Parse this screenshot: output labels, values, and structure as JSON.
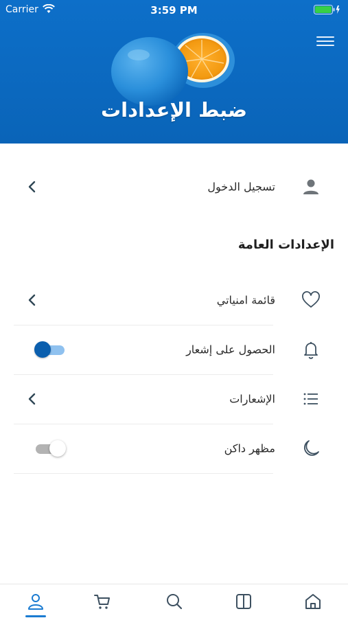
{
  "status_bar": {
    "carrier": "Carrier",
    "time": "3:59 PM"
  },
  "header": {
    "title": "ضبط الإعدادات",
    "menu_icon": "hamburger-menu-icon"
  },
  "login_row": {
    "label": "تسجيل الدخول",
    "icon": "person-icon"
  },
  "general_section": {
    "title": "الإعدادات العامة",
    "items": [
      {
        "label": "قائمة امنياتي",
        "icon": "heart-icon",
        "control": "chevron"
      },
      {
        "label": "الحصول على إشعار",
        "icon": "bell-icon",
        "control": "toggle",
        "value": true
      },
      {
        "label": "الإشعارات",
        "icon": "list-icon",
        "control": "chevron"
      },
      {
        "label": "مظهر داكن",
        "icon": "moon-icon",
        "control": "toggle",
        "value": false
      }
    ]
  },
  "tabbar": {
    "tabs": [
      {
        "icon": "profile-icon",
        "active": true
      },
      {
        "icon": "cart-icon",
        "active": false
      },
      {
        "icon": "search-icon",
        "active": false
      },
      {
        "icon": "book-icon",
        "active": false
      },
      {
        "icon": "home-icon",
        "active": false
      }
    ]
  },
  "colors": {
    "hero_blue": "#0d6fc9",
    "accent": "#1a7bd1",
    "toggle_on": "#0b5fae",
    "icon_gray": "#3d5060"
  }
}
